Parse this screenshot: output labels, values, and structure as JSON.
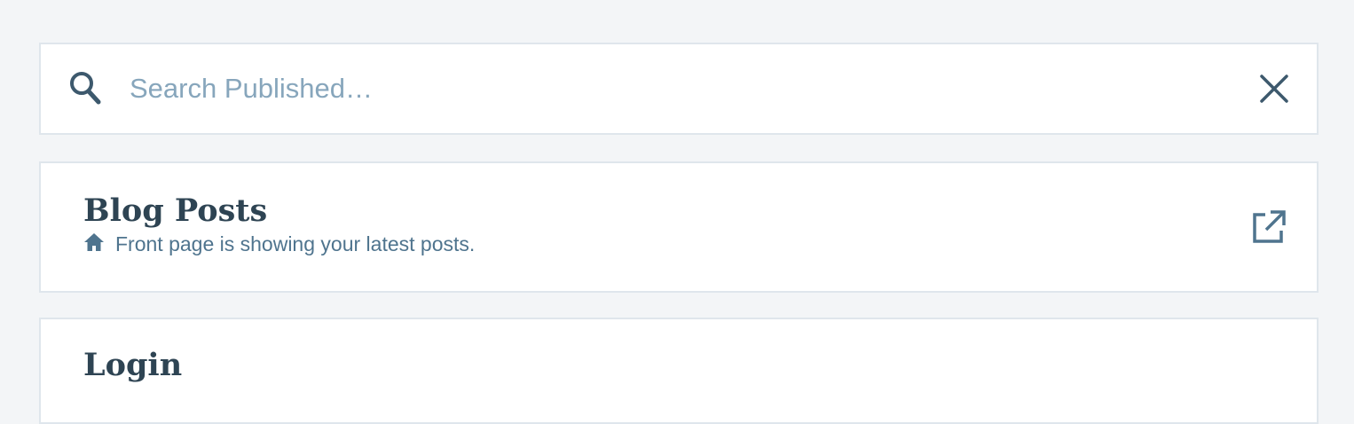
{
  "search": {
    "placeholder": "Search Published…",
    "value": "",
    "icon": "search-icon",
    "close_icon": "close-icon"
  },
  "pages": [
    {
      "title": "Blog Posts",
      "subtitle": "Front page is showing your latest posts.",
      "subtitle_icon": "home-icon",
      "action_icon": "external-link-icon"
    },
    {
      "title": "Login"
    }
  ],
  "colors": {
    "background": "#f3f5f7",
    "card": "#ffffff",
    "border": "#dfe6ec",
    "title": "#2e4453",
    "subtitle": "#4f748e",
    "placeholder": "#87a6bc",
    "icon": "#3d596d"
  }
}
